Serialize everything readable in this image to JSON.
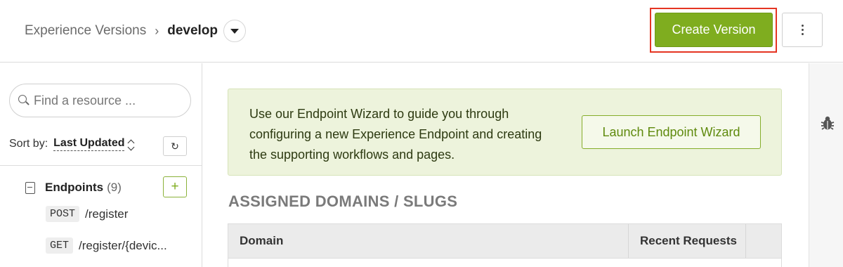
{
  "header": {
    "breadcrumb_root": "Experience Versions",
    "breadcrumb_separator": "›",
    "breadcrumb_current": "develop",
    "create_version_label": "Create Version"
  },
  "sidebar": {
    "search_placeholder": "Find a resource ...",
    "sort_label": "Sort by:",
    "sort_value": "Last Updated",
    "refresh_glyph": "↻",
    "endpoints": {
      "label": "Endpoints",
      "count": "(9)",
      "add_glyph": "+",
      "items": [
        {
          "method": "POST",
          "path": "/register"
        },
        {
          "method": "GET",
          "path": "/register/{devic..."
        }
      ]
    }
  },
  "main": {
    "banner_text": "Use our Endpoint Wizard to guide you through configuring a new Experience Endpoint and creating the supporting workflows and pages.",
    "launch_wizard_label": "Launch Endpoint Wizard",
    "section_title": "ASSIGNED DOMAINS / SLUGS",
    "table_columns": [
      "Domain",
      "Recent Requests"
    ]
  },
  "colors": {
    "primary_button": "#7fad1f",
    "highlight_outline": "#e53522",
    "banner_bg": "#edf3dc"
  },
  "icons": [
    "chevron-down-icon",
    "more-vertical-icon",
    "search-icon",
    "sort-arrows-icon",
    "refresh-icon",
    "document-icon",
    "plus-icon",
    "bug-icon"
  ]
}
